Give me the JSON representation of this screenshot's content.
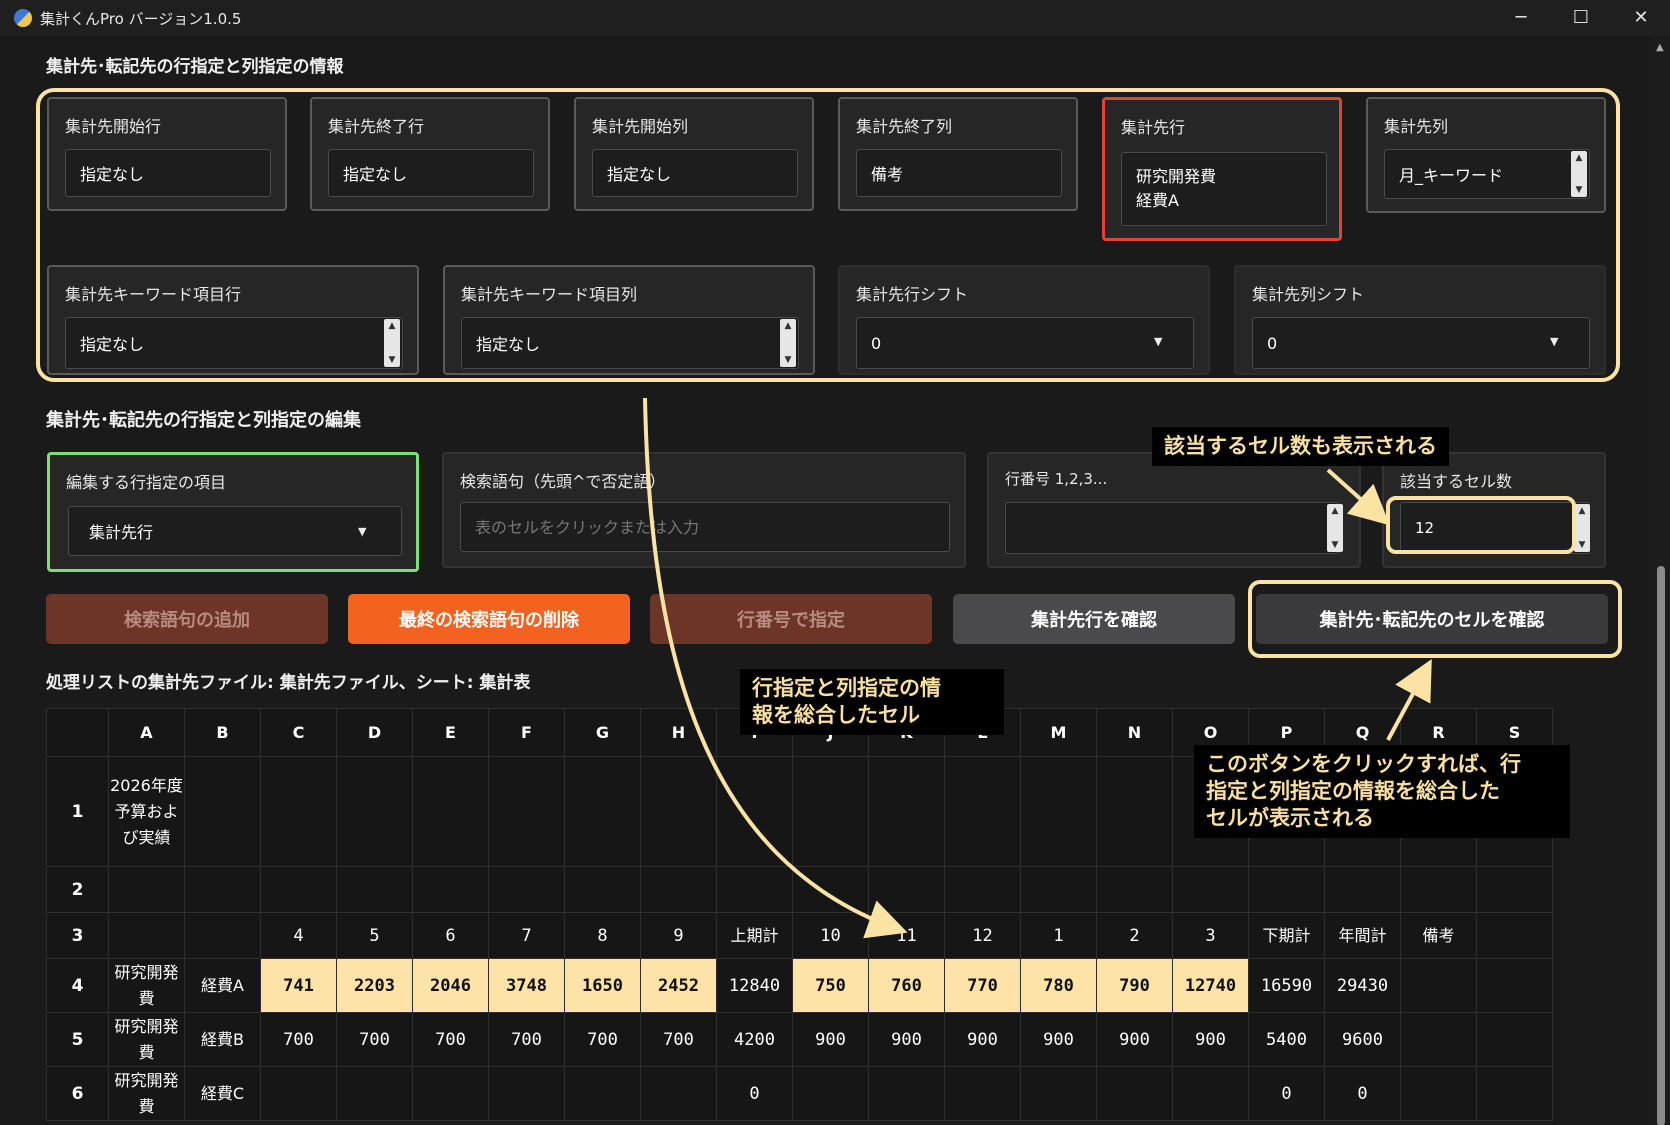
{
  "window": {
    "title": "集計くんPro バージョン1.0.5",
    "controls": [
      "─",
      "☐",
      "✕"
    ]
  },
  "section1": {
    "title": "集計先･転記先の行指定と列指定の情報",
    "cards": [
      {
        "label": "集計先開始行",
        "value": "指定なし"
      },
      {
        "label": "集計先終了行",
        "value": "指定なし"
      },
      {
        "label": "集計先開始列",
        "value": "指定なし"
      },
      {
        "label": "集計先終了列",
        "value": "備考"
      },
      {
        "label": "集計先行",
        "value_line1": "研究開発費",
        "value_line2": "経費A"
      },
      {
        "label": "集計先列",
        "value": "月_キーワード"
      },
      {
        "label": "集計先キーワード項目行",
        "value": "指定なし"
      },
      {
        "label": "集計先キーワード項目列",
        "value": "指定なし"
      },
      {
        "label": "集計先行シフト",
        "value": "0"
      },
      {
        "label": "集計先列シフト",
        "value": "0"
      }
    ]
  },
  "section2": {
    "title": "集計先･転記先の行指定と列指定の編集",
    "edit_item": {
      "label": "編集する行指定の項目",
      "value": "集計先行"
    },
    "search": {
      "label": "検索語句（先頭^で否定語）",
      "placeholder": "表のセルをクリックまたは入力"
    },
    "rownum": {
      "label": "行番号 1,2,3..."
    },
    "cellcount": {
      "label": "該当するセル数",
      "value": "12"
    }
  },
  "buttons": {
    "add_search": "検索語句の追加",
    "delete_last": "最終の検索語句の削除",
    "by_rownum": "行番号で指定",
    "confirm_row": "集計先行を確認",
    "confirm_cells": "集計先･転記先のセルを確認"
  },
  "file_info": "処理リストの集計先ファイル: 集計先ファイル、シート: 集計表",
  "table": {
    "col_headers": [
      "A",
      "B",
      "C",
      "D",
      "E",
      "F",
      "G",
      "H",
      "I",
      "J",
      "K",
      "L",
      "M",
      "N",
      "O",
      "P",
      "Q",
      "R",
      "S"
    ],
    "rows": [
      {
        "num": "1",
        "cells": [
          "2026年度予算および実績",
          "",
          "",
          "",
          "",
          "",
          "",
          "",
          "",
          "",
          "",
          "",
          "",
          "",
          "",
          "",
          "",
          "",
          ""
        ]
      },
      {
        "num": "2",
        "cells": [
          "",
          "",
          "",
          "",
          "",
          "",
          "",
          "",
          "",
          "",
          "",
          "",
          "",
          "",
          "",
          "",
          "",
          "",
          ""
        ]
      },
      {
        "num": "3",
        "cells": [
          "",
          "",
          "4",
          "5",
          "6",
          "7",
          "8",
          "9",
          "上期計",
          "10",
          "11",
          "12",
          "1",
          "2",
          "3",
          "下期計",
          "年間計",
          "備考",
          ""
        ]
      },
      {
        "num": "4",
        "cells": [
          "研究開発費",
          "経費A",
          "741",
          "2203",
          "2046",
          "3748",
          "1650",
          "2452",
          "12840",
          "750",
          "760",
          "770",
          "780",
          "790",
          "12740",
          "16590",
          "29430",
          "",
          ""
        ]
      },
      {
        "num": "5",
        "cells": [
          "研究開発費",
          "経費B",
          "700",
          "700",
          "700",
          "700",
          "700",
          "700",
          "4200",
          "900",
          "900",
          "900",
          "900",
          "900",
          "900",
          "5400",
          "9600",
          "",
          ""
        ]
      },
      {
        "num": "6",
        "cells": [
          "研究開発費",
          "経費C",
          "",
          "",
          "",
          "",
          "",
          "",
          "0",
          "",
          "",
          "",
          "",
          "",
          "",
          "0",
          "0",
          "",
          ""
        ]
      }
    ],
    "highlight_color": "#fde3a7"
  },
  "callouts": {
    "cell_count": "該当するセル数も表示される",
    "combined_line1": "行指定と列指定の情",
    "combined_line2": "報を総合したセル",
    "button_line1": "このボタンをクリックすれば、行",
    "button_line2": "指定と列指定の情報を総合した",
    "button_line3": "セルが表示される"
  },
  "colors": {
    "annotation_yellow": "#fbe4a3",
    "red_border": "#e1452f",
    "green_border": "#7ddf7a",
    "orange_button": "#f4621f",
    "brown_button": "#6d3428",
    "gray_button": "#4a4a4e"
  }
}
